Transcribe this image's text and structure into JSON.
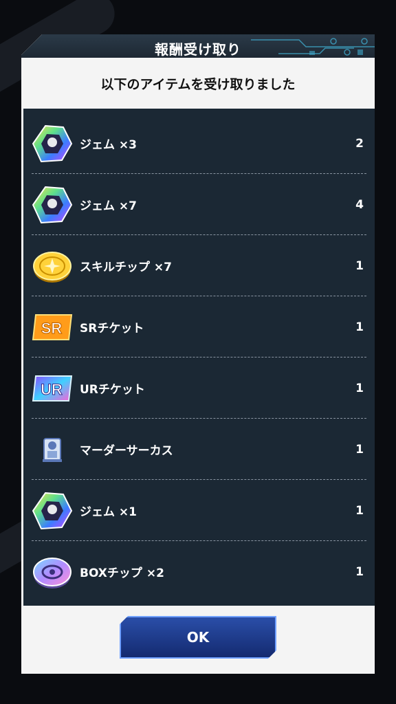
{
  "dialog": {
    "title": "報酬受け取り",
    "subtitle": "以下のアイテムを受け取りました",
    "ok_label": "OK"
  },
  "items": [
    {
      "name": "ジェム ×3",
      "count": "2",
      "icon": "gem-icon"
    },
    {
      "name": "ジェム ×7",
      "count": "4",
      "icon": "gem-icon"
    },
    {
      "name": "スキルチップ ×7",
      "count": "1",
      "icon": "skill-chip-icon"
    },
    {
      "name": "SRチケット",
      "count": "1",
      "icon": "sr-ticket-icon"
    },
    {
      "name": "URチケット",
      "count": "1",
      "icon": "ur-ticket-icon"
    },
    {
      "name": "マーダーサーカス",
      "count": "1",
      "icon": "card-character-icon"
    },
    {
      "name": "ジェム ×1",
      "count": "1",
      "icon": "gem-icon"
    },
    {
      "name": "BOXチップ ×2",
      "count": "1",
      "icon": "box-chip-icon"
    }
  ],
  "icon_text": {
    "sr": "SR",
    "ur": "UR"
  },
  "colors": {
    "panel": "#1b2834",
    "dialog": "#f4f4f4",
    "button": "#1f3c8c"
  }
}
